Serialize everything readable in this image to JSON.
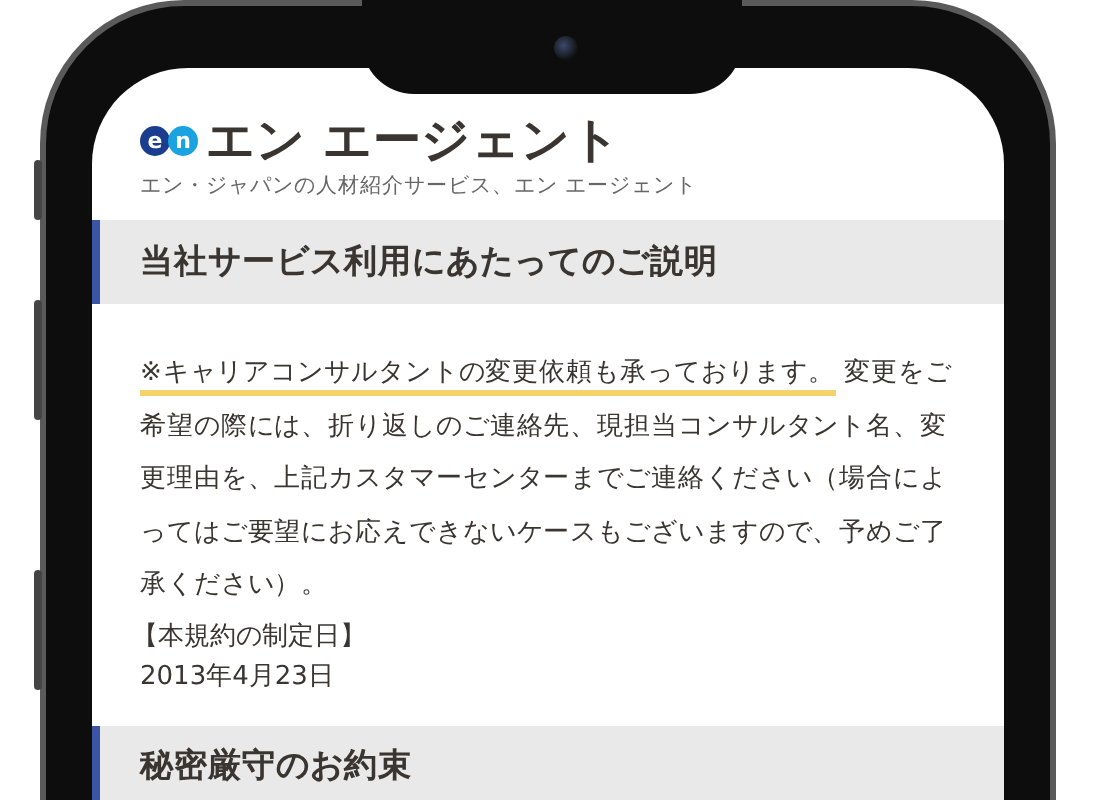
{
  "header": {
    "logo_mark": [
      "e",
      "n"
    ],
    "logo_text": "エン エージェント",
    "tagline": "エン・ジャパンの人材紹介サービス、エン エージェント"
  },
  "sections": [
    {
      "title": "当社サービス利用にあたってのご説明",
      "highlight": "※キャリアコンサルタントの変更依頼も承っております。",
      "body": " 変更をご希望の際には、折り返しのご連絡先、現担当コンサルタント名、変更理由を、上記カスタマーセンターまでご連絡ください（場合によってはご要望にお応えできないケースもございますので、予めご了承ください）。",
      "date_label": "【本規約の制定日】",
      "date": "2013年4月23日"
    },
    {
      "title": "秘密厳守のお約束"
    }
  ]
}
